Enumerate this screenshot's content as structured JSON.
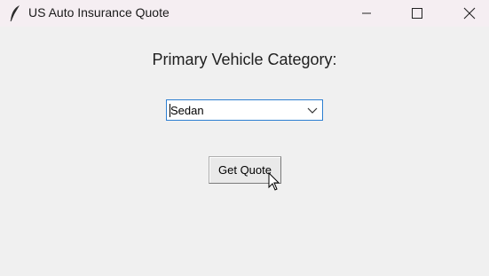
{
  "window": {
    "title": "US Auto Insurance Quote",
    "icon": "feather-icon",
    "controls": [
      "minimize-icon",
      "maximize-icon",
      "close-icon"
    ]
  },
  "form": {
    "prompt_label": "Primary Vehicle Category:",
    "vehicle_select": {
      "selected_value": "Sedan",
      "icon": "chevron-down-icon"
    },
    "submit_button": {
      "label": "Get Quote"
    }
  },
  "colors": {
    "titlebar_bg": "#f5eef2",
    "window_bg": "#f0f0f0",
    "focus_border": "#2d7fd1"
  }
}
